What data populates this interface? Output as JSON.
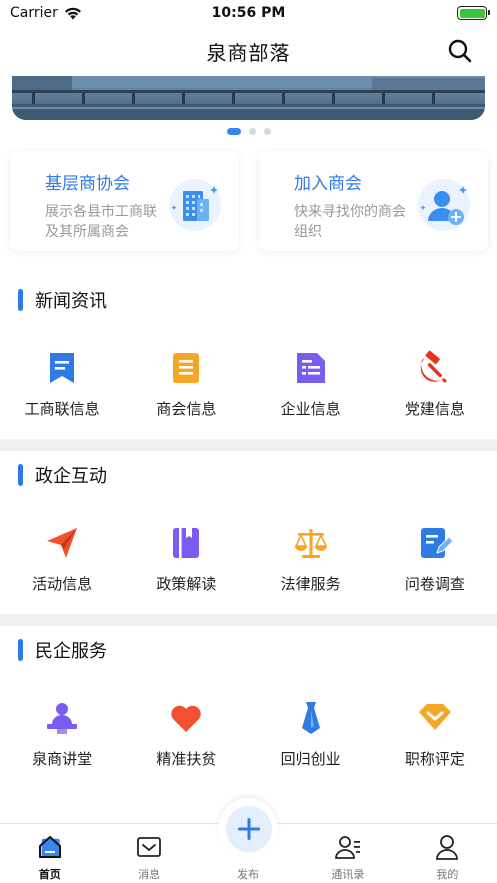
{
  "status_bar": {
    "carrier": "Carrier",
    "time": "10:56 PM"
  },
  "header": {
    "title": "泉商部落"
  },
  "cards": [
    {
      "title": "基层商协会",
      "desc": "展示各县市工商联及其所属商会"
    },
    {
      "title": "加入商会",
      "desc": "快来寻找你的商会组织"
    }
  ],
  "sections": [
    {
      "title": "新闻资讯",
      "items": [
        {
          "label": "工商联信息",
          "icon": "bookmark-icon"
        },
        {
          "label": "商会信息",
          "icon": "document-icon"
        },
        {
          "label": "企业信息",
          "icon": "file-list-icon"
        },
        {
          "label": "党建信息",
          "icon": "hammer-sickle-icon"
        }
      ]
    },
    {
      "title": "政企互动",
      "items": [
        {
          "label": "活动信息",
          "icon": "paper-plane-icon"
        },
        {
          "label": "政策解读",
          "icon": "book-icon"
        },
        {
          "label": "法律服务",
          "icon": "scale-icon"
        },
        {
          "label": "问卷调查",
          "icon": "edit-form-icon"
        }
      ]
    },
    {
      "title": "民企服务",
      "items": [
        {
          "label": "泉商讲堂",
          "icon": "lecturer-icon"
        },
        {
          "label": "精准扶贫",
          "icon": "heart-icon"
        },
        {
          "label": "回归创业",
          "icon": "tie-icon"
        },
        {
          "label": "职称评定",
          "icon": "badge-chevron-icon"
        }
      ]
    }
  ],
  "tabbar": {
    "home": "首页",
    "messages": "消息",
    "publish": "发布",
    "contacts": "通讯录",
    "mine": "我的"
  },
  "colors": {
    "accent": "#2f7ae5"
  }
}
